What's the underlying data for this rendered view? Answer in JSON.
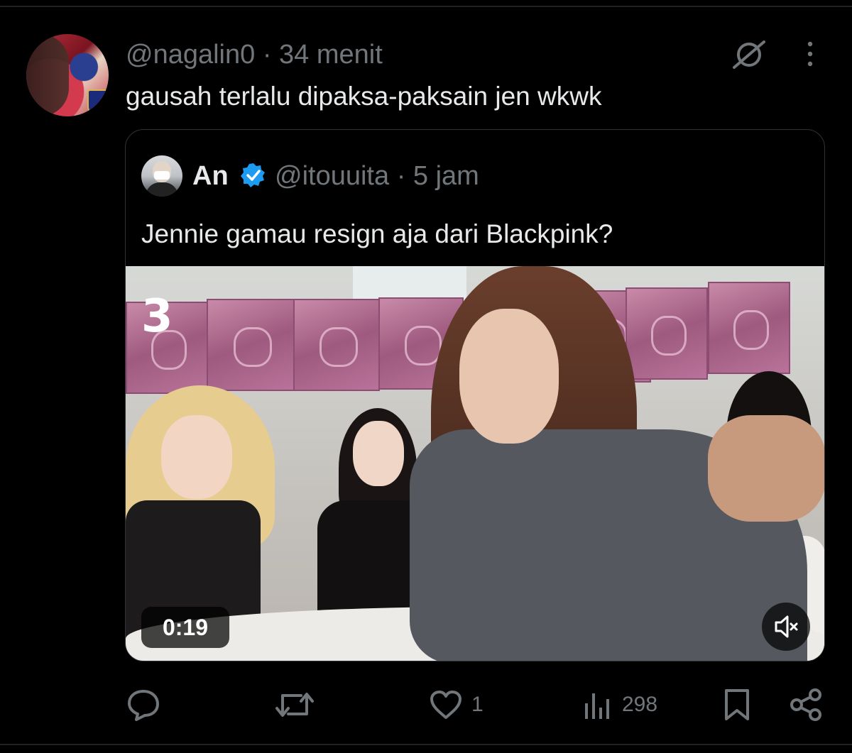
{
  "reply": {
    "handle": "@nagalin0",
    "time": "34 menit",
    "text": "gausah terlalu dipaksa-paksain jen wkwk"
  },
  "quote": {
    "name": "An",
    "handle": "@itouuita",
    "time": "5 jam",
    "text": "Jennie gamau resign aja dari Blackpink?",
    "video": {
      "duration": "0:19",
      "logo": "3",
      "muted": true
    }
  },
  "actions": {
    "reply_count": "",
    "repost_count": "",
    "like_count": "1",
    "views_count": "298"
  },
  "colors": {
    "background": "#000000",
    "text": "#e7e9ea",
    "secondary": "#71767b",
    "verified": "#1d9bf0",
    "border": "#2f3336"
  },
  "icons": [
    "grok-icon",
    "more-icon",
    "verified-icon",
    "mute-icon",
    "reply-icon",
    "repost-icon",
    "like-icon",
    "views-icon",
    "bookmark-icon",
    "share-icon"
  ]
}
